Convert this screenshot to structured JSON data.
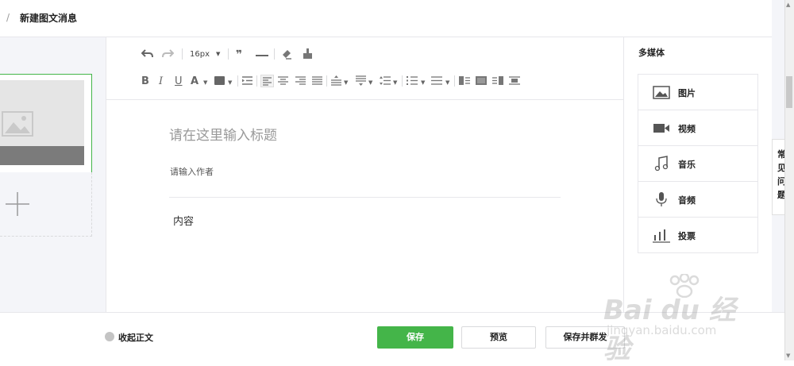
{
  "header": {
    "separator": "/",
    "title": "新建图文消息"
  },
  "toolbar": {
    "font_size": "16px",
    "row1_icons": [
      "undo-icon",
      "redo-icon",
      "font-size-select",
      "blockquote-icon",
      "horizontal-rule-icon",
      "clear-format-icon",
      "format-brush-icon"
    ],
    "row2_icons": [
      "bold-icon",
      "italic-icon",
      "underline-icon",
      "font-color-icon",
      "background-color-icon",
      "indent-icon",
      "align-left-icon",
      "align-center-icon",
      "align-right-icon",
      "align-justify-icon",
      "line-spacing-top-icon",
      "line-spacing-bottom-icon",
      "line-height-icon",
      "ordered-list-icon",
      "unordered-list-icon",
      "float-left-icon",
      "float-none-icon",
      "float-right-icon",
      "image-center-icon"
    ]
  },
  "editor": {
    "title_placeholder": "请在这里输入标题",
    "author_placeholder": "请输入作者",
    "content": "内容"
  },
  "media": {
    "heading": "多媒体",
    "items": [
      {
        "label": "图片",
        "icon": "image-icon"
      },
      {
        "label": "视频",
        "icon": "video-icon"
      },
      {
        "label": "音乐",
        "icon": "music-icon"
      },
      {
        "label": "音频",
        "icon": "microphone-icon"
      },
      {
        "label": "投票",
        "icon": "bar-chart-icon"
      }
    ]
  },
  "side_tab": {
    "text": "常见问题"
  },
  "footer": {
    "collapse_label": "收起正文",
    "save": "保存",
    "preview": "预览",
    "save_and_send": "保存并群发"
  },
  "colors": {
    "accent": "#44b549",
    "border": "#e7e7eb",
    "panel_bg": "#f4f5f9"
  }
}
